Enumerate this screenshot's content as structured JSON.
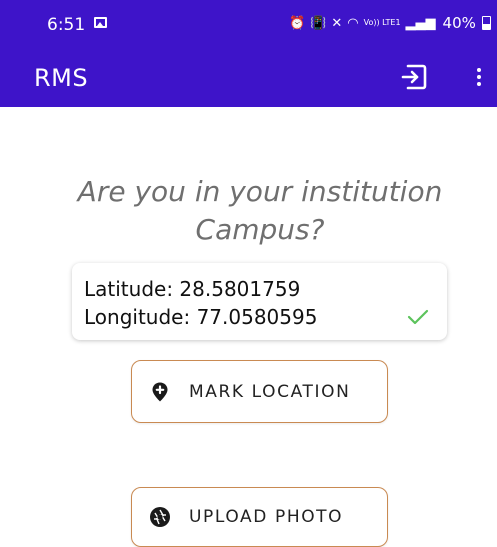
{
  "status_bar": {
    "time": "6:51",
    "network_label": "Vo)) LTE1",
    "battery_percent": "40%",
    "icons": [
      "gallery-icon",
      "alarm-icon",
      "vibrate-icon",
      "mute-icon",
      "wifi-icon",
      "signal-icon",
      "battery-icon"
    ]
  },
  "app_bar": {
    "title": "RMS",
    "icons": [
      "logout-icon",
      "more-vert-icon"
    ]
  },
  "main": {
    "question": "Are you in your institution Campus?",
    "latitude_label": "Latitude: 28.5801759",
    "longitude_label": "Longitude: 77.0580595",
    "location_verified": true,
    "mark_location_label": "MARK LOCATION",
    "upload_photo_label": "UPLOAD PHOTO"
  },
  "colors": {
    "primary": "#3e14c9",
    "button_border": "#c98a52",
    "check": "#5cc35c",
    "question_text": "#6f6f6f"
  }
}
